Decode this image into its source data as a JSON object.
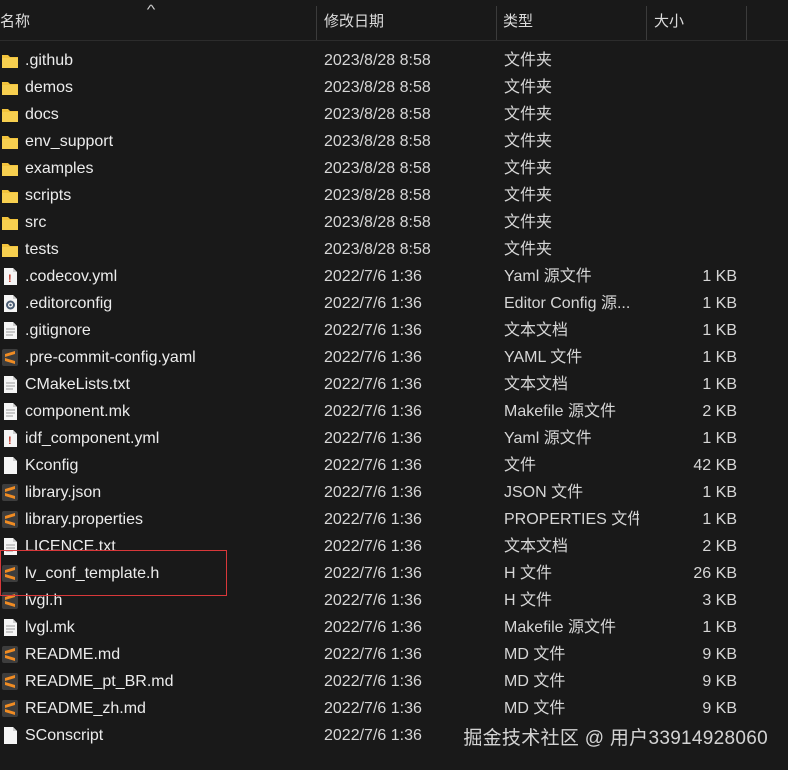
{
  "header": {
    "name_label": "名称",
    "date_label": "修改日期",
    "type_label": "类型",
    "size_label": "大小",
    "sort_icon": "sort-up-icon"
  },
  "files": [
    {
      "name": ".github",
      "date": "2023/8/28 8:58",
      "type": "文件夹",
      "size": "",
      "icon": "folder"
    },
    {
      "name": "demos",
      "date": "2023/8/28 8:58",
      "type": "文件夹",
      "size": "",
      "icon": "folder"
    },
    {
      "name": "docs",
      "date": "2023/8/28 8:58",
      "type": "文件夹",
      "size": "",
      "icon": "folder"
    },
    {
      "name": "env_support",
      "date": "2023/8/28 8:58",
      "type": "文件夹",
      "size": "",
      "icon": "folder"
    },
    {
      "name": "examples",
      "date": "2023/8/28 8:58",
      "type": "文件夹",
      "size": "",
      "icon": "folder"
    },
    {
      "name": "scripts",
      "date": "2023/8/28 8:58",
      "type": "文件夹",
      "size": "",
      "icon": "folder"
    },
    {
      "name": "src",
      "date": "2023/8/28 8:58",
      "type": "文件夹",
      "size": "",
      "icon": "folder"
    },
    {
      "name": "tests",
      "date": "2023/8/28 8:58",
      "type": "文件夹",
      "size": "",
      "icon": "folder"
    },
    {
      "name": ".codecov.yml",
      "date": "2022/7/6 1:36",
      "type": "Yaml 源文件",
      "size": "1 KB",
      "icon": "yaml"
    },
    {
      "name": ".editorconfig",
      "date": "2022/7/6 1:36",
      "type": "Editor Config 源...",
      "size": "1 KB",
      "icon": "config"
    },
    {
      "name": ".gitignore",
      "date": "2022/7/6 1:36",
      "type": "文本文档",
      "size": "1 KB",
      "icon": "text"
    },
    {
      "name": ".pre-commit-config.yaml",
      "date": "2022/7/6 1:36",
      "type": "YAML 文件",
      "size": "1 KB",
      "icon": "sublime"
    },
    {
      "name": "CMakeLists.txt",
      "date": "2022/7/6 1:36",
      "type": "文本文档",
      "size": "1 KB",
      "icon": "text"
    },
    {
      "name": "component.mk",
      "date": "2022/7/6 1:36",
      "type": "Makefile 源文件",
      "size": "2 KB",
      "icon": "text"
    },
    {
      "name": "idf_component.yml",
      "date": "2022/7/6 1:36",
      "type": "Yaml 源文件",
      "size": "1 KB",
      "icon": "yaml"
    },
    {
      "name": "Kconfig",
      "date": "2022/7/6 1:36",
      "type": "文件",
      "size": "42 KB",
      "icon": "blank"
    },
    {
      "name": "library.json",
      "date": "2022/7/6 1:36",
      "type": "JSON 文件",
      "size": "1 KB",
      "icon": "sublime"
    },
    {
      "name": "library.properties",
      "date": "2022/7/6 1:36",
      "type": "PROPERTIES 文件",
      "size": "1 KB",
      "icon": "sublime"
    },
    {
      "name": "LICENCE.txt",
      "date": "2022/7/6 1:36",
      "type": "文本文档",
      "size": "2 KB",
      "icon": "text"
    },
    {
      "name": "lv_conf_template.h",
      "date": "2022/7/6 1:36",
      "type": "H 文件",
      "size": "26 KB",
      "icon": "sublime"
    },
    {
      "name": "lvgl.h",
      "date": "2022/7/6 1:36",
      "type": "H 文件",
      "size": "3 KB",
      "icon": "sublime"
    },
    {
      "name": "lvgl.mk",
      "date": "2022/7/6 1:36",
      "type": "Makefile 源文件",
      "size": "1 KB",
      "icon": "text"
    },
    {
      "name": "README.md",
      "date": "2022/7/6 1:36",
      "type": "MD 文件",
      "size": "9 KB",
      "icon": "sublime"
    },
    {
      "name": "README_pt_BR.md",
      "date": "2022/7/6 1:36",
      "type": "MD 文件",
      "size": "9 KB",
      "icon": "sublime"
    },
    {
      "name": "README_zh.md",
      "date": "2022/7/6 1:36",
      "type": "MD 文件",
      "size": "9 KB",
      "icon": "sublime"
    },
    {
      "name": "SConscript",
      "date": "2022/7/6 1:36",
      "type": "",
      "size": "",
      "icon": "blank"
    }
  ],
  "watermark": "掘金技术社区 @ 用户3391492806​0",
  "colors": {
    "background": "#191919",
    "folder": "#f2c33c",
    "sublime_orange": "#f08c23",
    "highlight_border": "#d8383a"
  }
}
